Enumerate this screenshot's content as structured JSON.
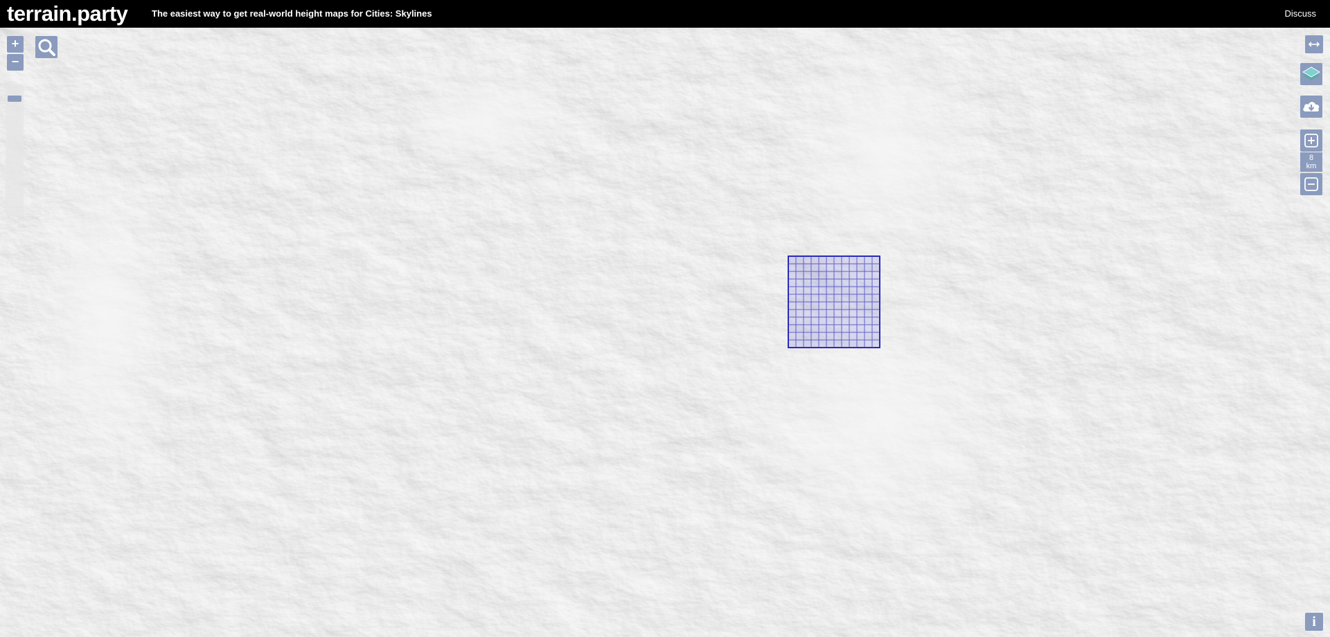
{
  "header": {
    "logo": "terrain.party",
    "tagline_prefix": "The easiest way to get real-world height maps for ",
    "tagline_bold": "Cities: Skylines",
    "discuss_label": "Discuss"
  },
  "map_controls": {
    "zoom_in_label": "+",
    "zoom_out_label": "−",
    "zoom_level_fraction": 0.06,
    "search_icon": "search-icon"
  },
  "right_controls": {
    "resize_icon": "horizontal-arrows-icon",
    "layers_icon": "layers-icon",
    "download_icon": "cloud-download-icon",
    "enlarge_icon": "plus-box-icon",
    "scale_value": "8",
    "scale_unit": "km",
    "shrink_icon": "minus-box-icon",
    "info_label": "i"
  },
  "colors": {
    "button_bg": "#8a9bbd",
    "selection_stroke": "#2a2ab8",
    "selection_fill": "rgba(100,100,220,0.18)",
    "header_bg": "#000000"
  }
}
